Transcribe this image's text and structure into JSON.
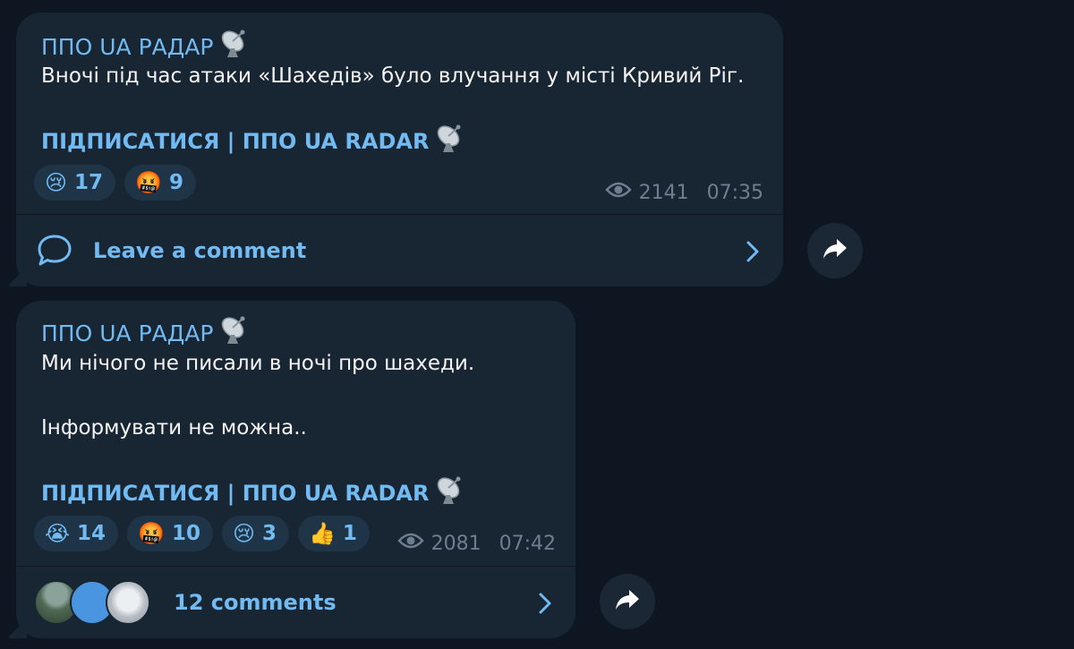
{
  "messages": [
    {
      "sender": "ППО UA РАДАР",
      "lines": [
        "Вночі під час атаки «Шахедів» було влучання у місті Кривий Ріг."
      ],
      "subscribe": "ПІДПИСАТИСЯ | ППО UA RADAR",
      "reactions": [
        {
          "emoji": "😢",
          "count": "17"
        },
        {
          "emoji": "🤬",
          "count": "9"
        }
      ],
      "views": "2141",
      "time": "07:35",
      "comment_label": "Leave a comment"
    },
    {
      "sender": "ППО UA РАДАР",
      "lines": [
        "Ми нічого не писали в ночі про шахеди.",
        "Інформувати не можна.."
      ],
      "subscribe": "ПІДПИСАТИСЯ | ППО UA RADAR",
      "reactions": [
        {
          "emoji": "😭",
          "count": "14"
        },
        {
          "emoji": "🤬",
          "count": "10"
        },
        {
          "emoji": "😢",
          "count": "3"
        },
        {
          "emoji": "👍",
          "count": "1"
        }
      ],
      "views": "2081",
      "time": "07:42",
      "comment_label": "12 comments"
    }
  ],
  "icons": {
    "satellite": "satellite-dish-icon",
    "eye": "eye-icon",
    "comment": "comment-bubble-icon",
    "chevron": "chevron-right-icon",
    "share": "share-arrow-icon"
  },
  "colors": {
    "background": "#0e1621",
    "bubble": "#182533",
    "accent": "#71baf2",
    "text": "#f5f5f5",
    "meta": "#6d7f8f",
    "reaction_bg": "#1f3447"
  }
}
